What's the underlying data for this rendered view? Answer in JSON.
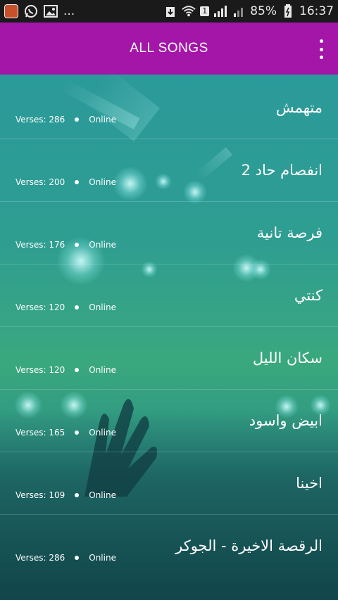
{
  "status_bar": {
    "icons": [
      "app-avatar-icon",
      "whatsapp-icon",
      "image-icon",
      "more-notifications-icon",
      "download-icon",
      "wifi-icon",
      "sim-icon",
      "signal-icon",
      "signal2-icon",
      "battery-icon"
    ],
    "more": "...",
    "sim": "1",
    "battery": "85%",
    "time": "16:37"
  },
  "app_bar": {
    "title": "ALL SONGS",
    "background": "#a316a8"
  },
  "songs": [
    {
      "title": "متهمش",
      "verses": "Verses: 286",
      "status": "Online"
    },
    {
      "title": "انفصام حاد 2",
      "verses": "Verses: 200",
      "status": "Online"
    },
    {
      "title": "فرصة تانية",
      "verses": "Verses: 176",
      "status": "Online"
    },
    {
      "title": "كنتي",
      "verses": "Verses: 120",
      "status": "Online"
    },
    {
      "title": "سكان الليل",
      "verses": "Verses: 120",
      "status": "Online"
    },
    {
      "title": "ابيض واسود",
      "verses": "Verses: 165",
      "status": "Online"
    },
    {
      "title": "اخينا",
      "verses": "Verses: 109",
      "status": "Online"
    },
    {
      "title": "الرقصة الاخيرة - الجوكر",
      "verses": "Verses: 286",
      "status": "Online"
    }
  ]
}
